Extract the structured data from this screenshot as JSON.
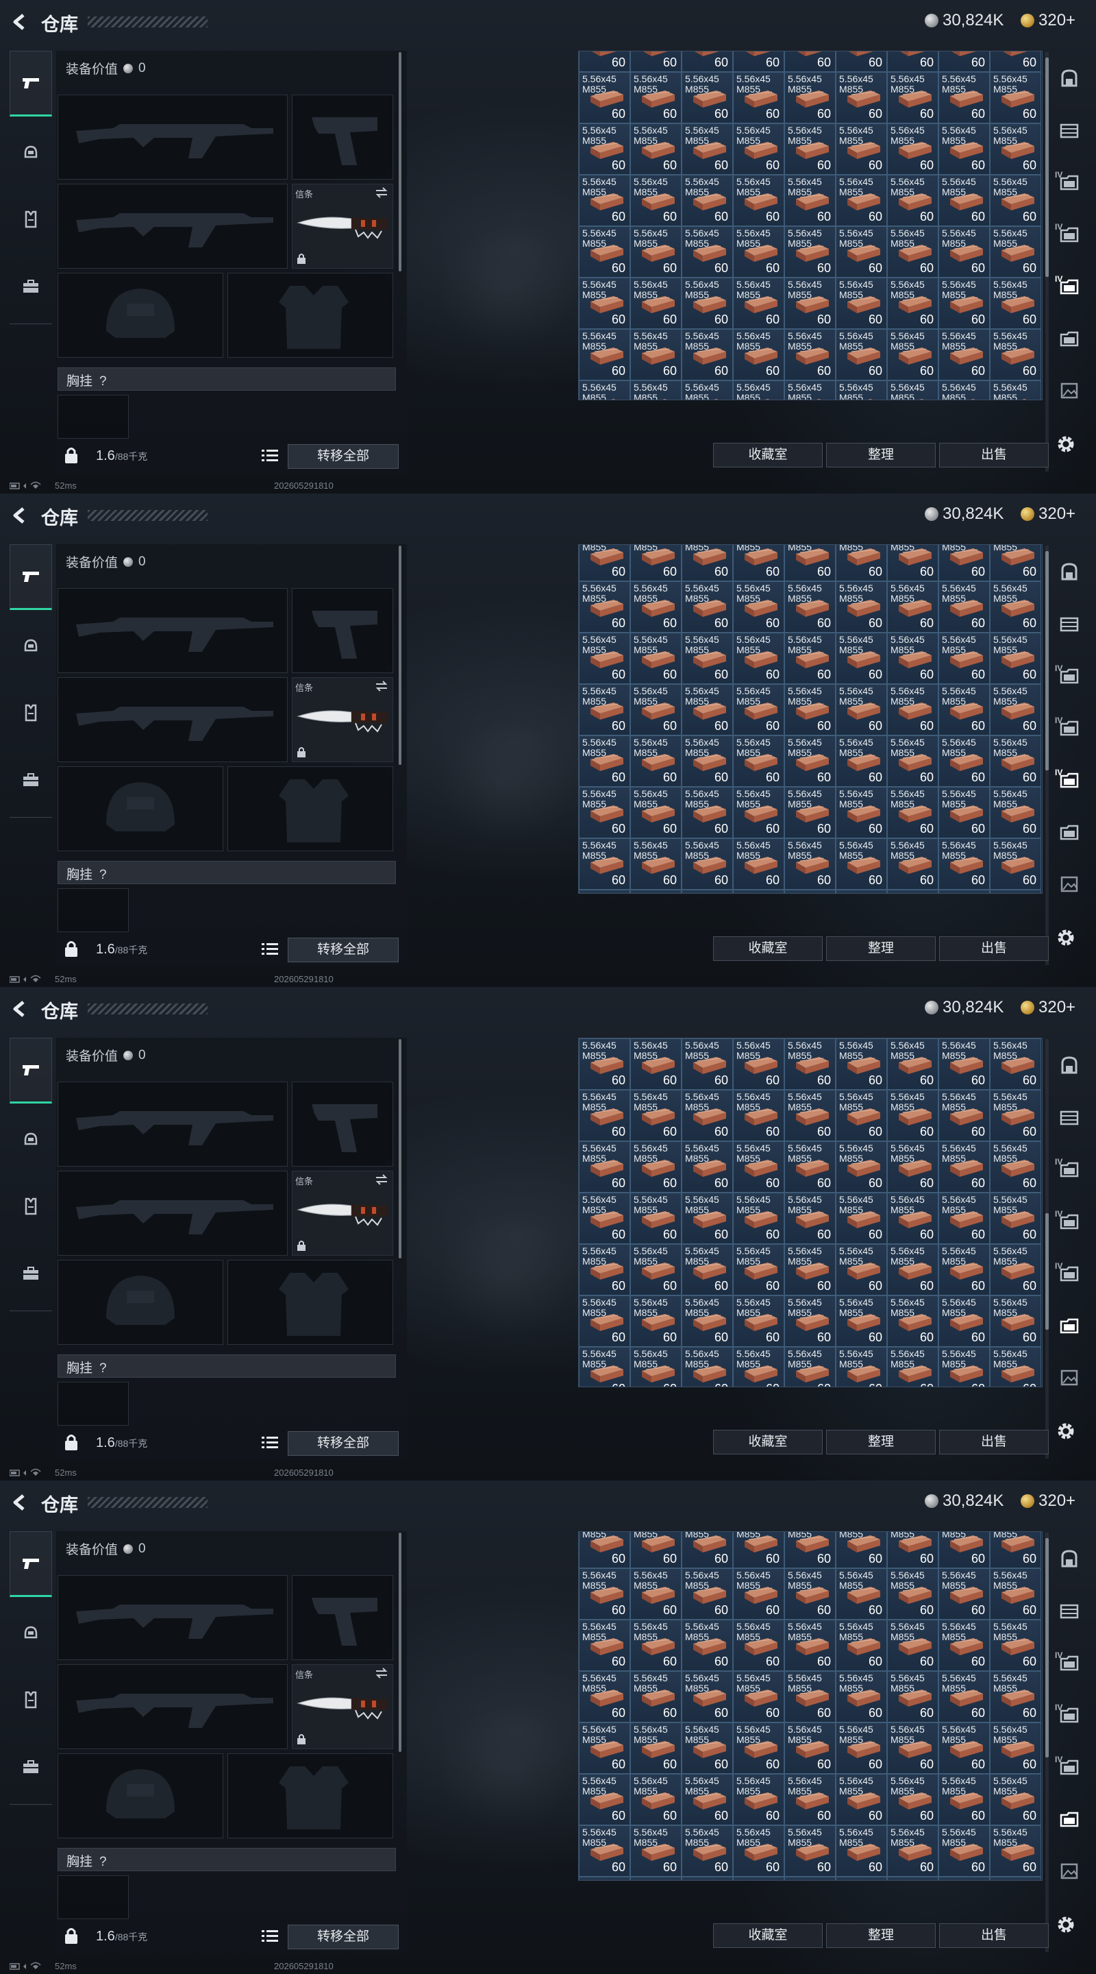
{
  "screen": {
    "title": "仓库",
    "silver_amount": "30,824K",
    "gold_amount": "320+",
    "equip_value_label": "装备价值",
    "equip_value": "0",
    "knife_slot_label": "信条",
    "chest_rig_label": "胸挂",
    "chest_rig_hint": "?",
    "weight_current": "1.6",
    "weight_max": "/88千克",
    "transfer_all_label": "转移全部",
    "ammo_name": "5.56x45\nM855",
    "ammo_count": "60",
    "buttons": {
      "collection": "收藏室",
      "sort": "整理",
      "sell": "出售"
    },
    "status": {
      "ping": "52ms",
      "build": "202605291810"
    },
    "right_tabs": [
      {
        "label": "",
        "icon": "bag-icon"
      },
      {
        "label": "",
        "icon": "crate-icon"
      },
      {
        "label": "IV",
        "icon": "folder-icon"
      },
      {
        "label": "IV",
        "icon": "folder-icon"
      },
      {
        "label": "IV",
        "icon": "folder-icon"
      },
      {
        "label": "",
        "icon": "folder-icon"
      },
      {
        "label": "",
        "icon": "image-icon"
      }
    ],
    "left_nav": [
      "pistol-icon",
      "helmet-icon",
      "vest-icon",
      "briefcase-icon"
    ],
    "colors": {
      "accent": "#2fd6a4",
      "cell_bg": "#22354c",
      "cell_border": "#3e5b78"
    }
  },
  "frames": [
    {
      "grid_offset_row": -0.6,
      "active_right_tab": 4
    },
    {
      "grid_offset_row": -0.3,
      "active_right_tab": 4
    },
    {
      "grid_offset_row": 0,
      "active_right_tab": 5
    },
    {
      "grid_offset_row": -0.3,
      "active_right_tab": 5
    }
  ]
}
